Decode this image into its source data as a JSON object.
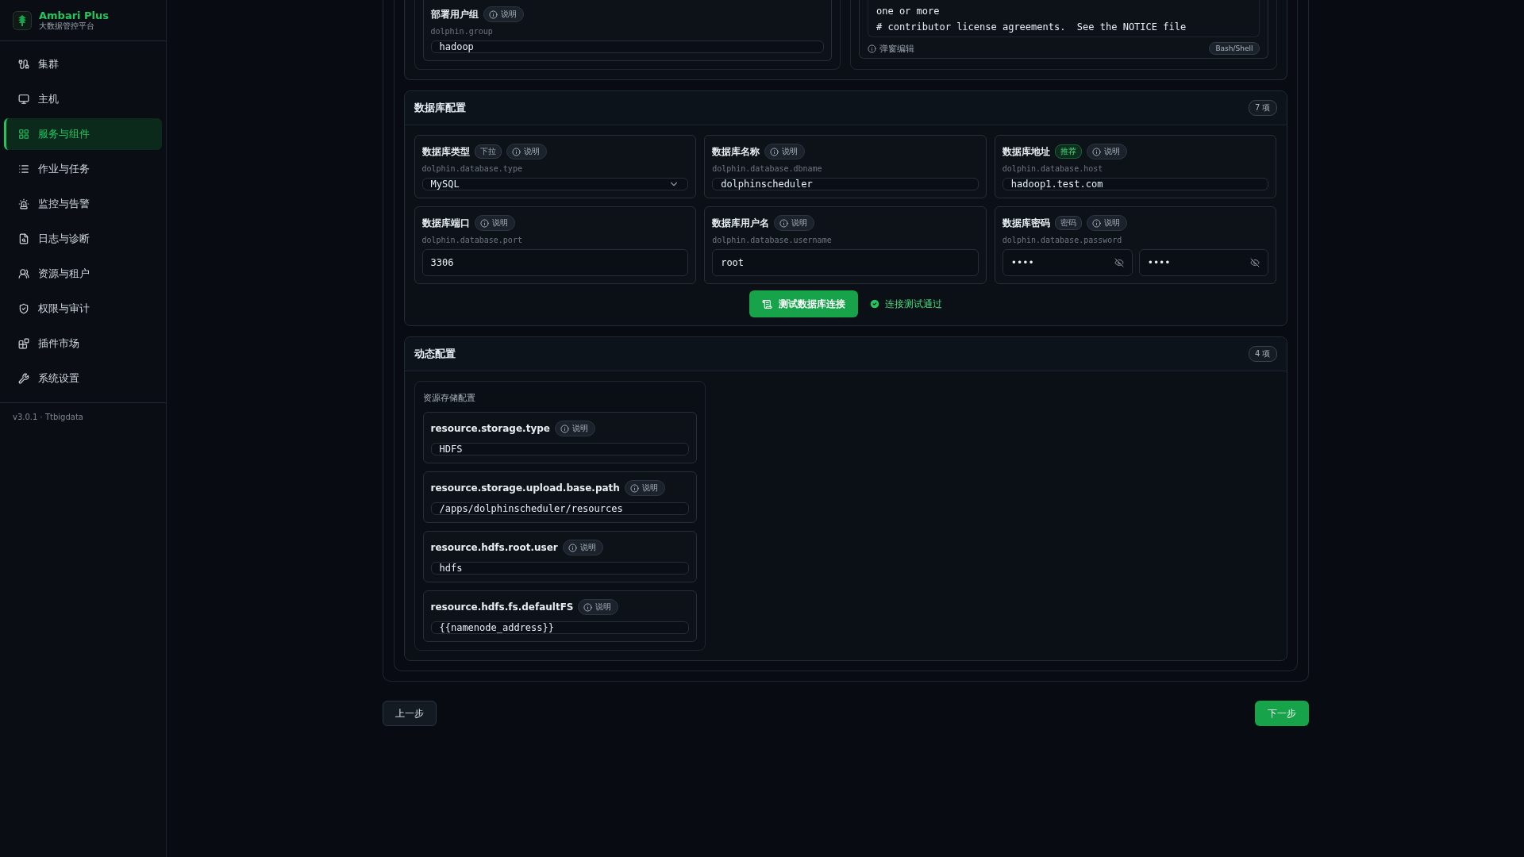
{
  "sidebar": {
    "brand": {
      "name": "Ambari Plus",
      "subtitle": "大数据管控平台"
    },
    "items": [
      {
        "label": "集群",
        "selected": false
      },
      {
        "label": "主机",
        "selected": false
      },
      {
        "label": "服务与组件",
        "selected": true
      },
      {
        "label": "作业与任务",
        "selected": false
      },
      {
        "label": "监控与告警",
        "selected": false
      },
      {
        "label": "日志与诊断",
        "selected": false
      },
      {
        "label": "资源与租户",
        "selected": false
      },
      {
        "label": "权限与审计",
        "selected": false
      },
      {
        "label": "插件市场",
        "selected": false
      },
      {
        "label": "系统设置",
        "selected": false
      }
    ],
    "version": "v3.0.1 · Ttbigdata"
  },
  "top_section": {
    "field": {
      "label": "部署用户组",
      "help": "说明",
      "key": "dolphin.group",
      "value": "hadoop"
    },
    "editor": {
      "lines": [
        "one or more",
        "# contributor license agreements.  See the NOTICE file"
      ],
      "action": "弹窗编辑",
      "language": "Bash/Shell"
    }
  },
  "database_section": {
    "title": "数据库配置",
    "count": "7 项",
    "fields": [
      {
        "kind": "select",
        "label": "数据库类型",
        "tag": {
          "text": "下拉",
          "kind": "plain"
        },
        "help": "说明",
        "key": "dolphin.database.type",
        "value": "MySQL"
      },
      {
        "kind": "text",
        "label": "数据库名称",
        "help": "说明",
        "key": "dolphin.database.dbname",
        "value": "dolphinscheduler"
      },
      {
        "kind": "text",
        "label": "数据库地址",
        "tag": {
          "text": "推荐",
          "kind": "recommended"
        },
        "help": "说明",
        "key": "dolphin.database.host",
        "value": "hadoop1.test.com"
      },
      {
        "kind": "text",
        "label": "数据库端口",
        "help": "说明",
        "key": "dolphin.database.port",
        "value": "3306"
      },
      {
        "kind": "text",
        "label": "数据库用户名",
        "help": "说明",
        "key": "dolphin.database.username",
        "value": "root"
      },
      {
        "kind": "password",
        "label": "数据库密码",
        "tag": {
          "text": "密码",
          "kind": "plain"
        },
        "help": "说明",
        "key": "dolphin.database.password",
        "values": [
          "••••",
          "••••"
        ]
      }
    ],
    "test_button": "测试数据库连接",
    "test_status": "连接测试通过"
  },
  "dynamic_section": {
    "title": "动态配置",
    "count": "4 项",
    "groups": [
      {
        "title": "资源存储配置",
        "fields": [
          {
            "label": "resource.storage.type",
            "help": "说明",
            "value": "HDFS"
          },
          {
            "label": "resource.storage.upload.base.path",
            "help": "说明",
            "value": "/apps/dolphinscheduler/resources"
          },
          {
            "label": "resource.hdfs.root.user",
            "help": "说明",
            "value": "hdfs"
          },
          {
            "label": "resource.hdfs.fs.defaultFS",
            "help": "说明",
            "value": "{{namenode_address}}"
          }
        ]
      }
    ]
  },
  "footer": {
    "prev": "上一步",
    "next": "下一步"
  }
}
